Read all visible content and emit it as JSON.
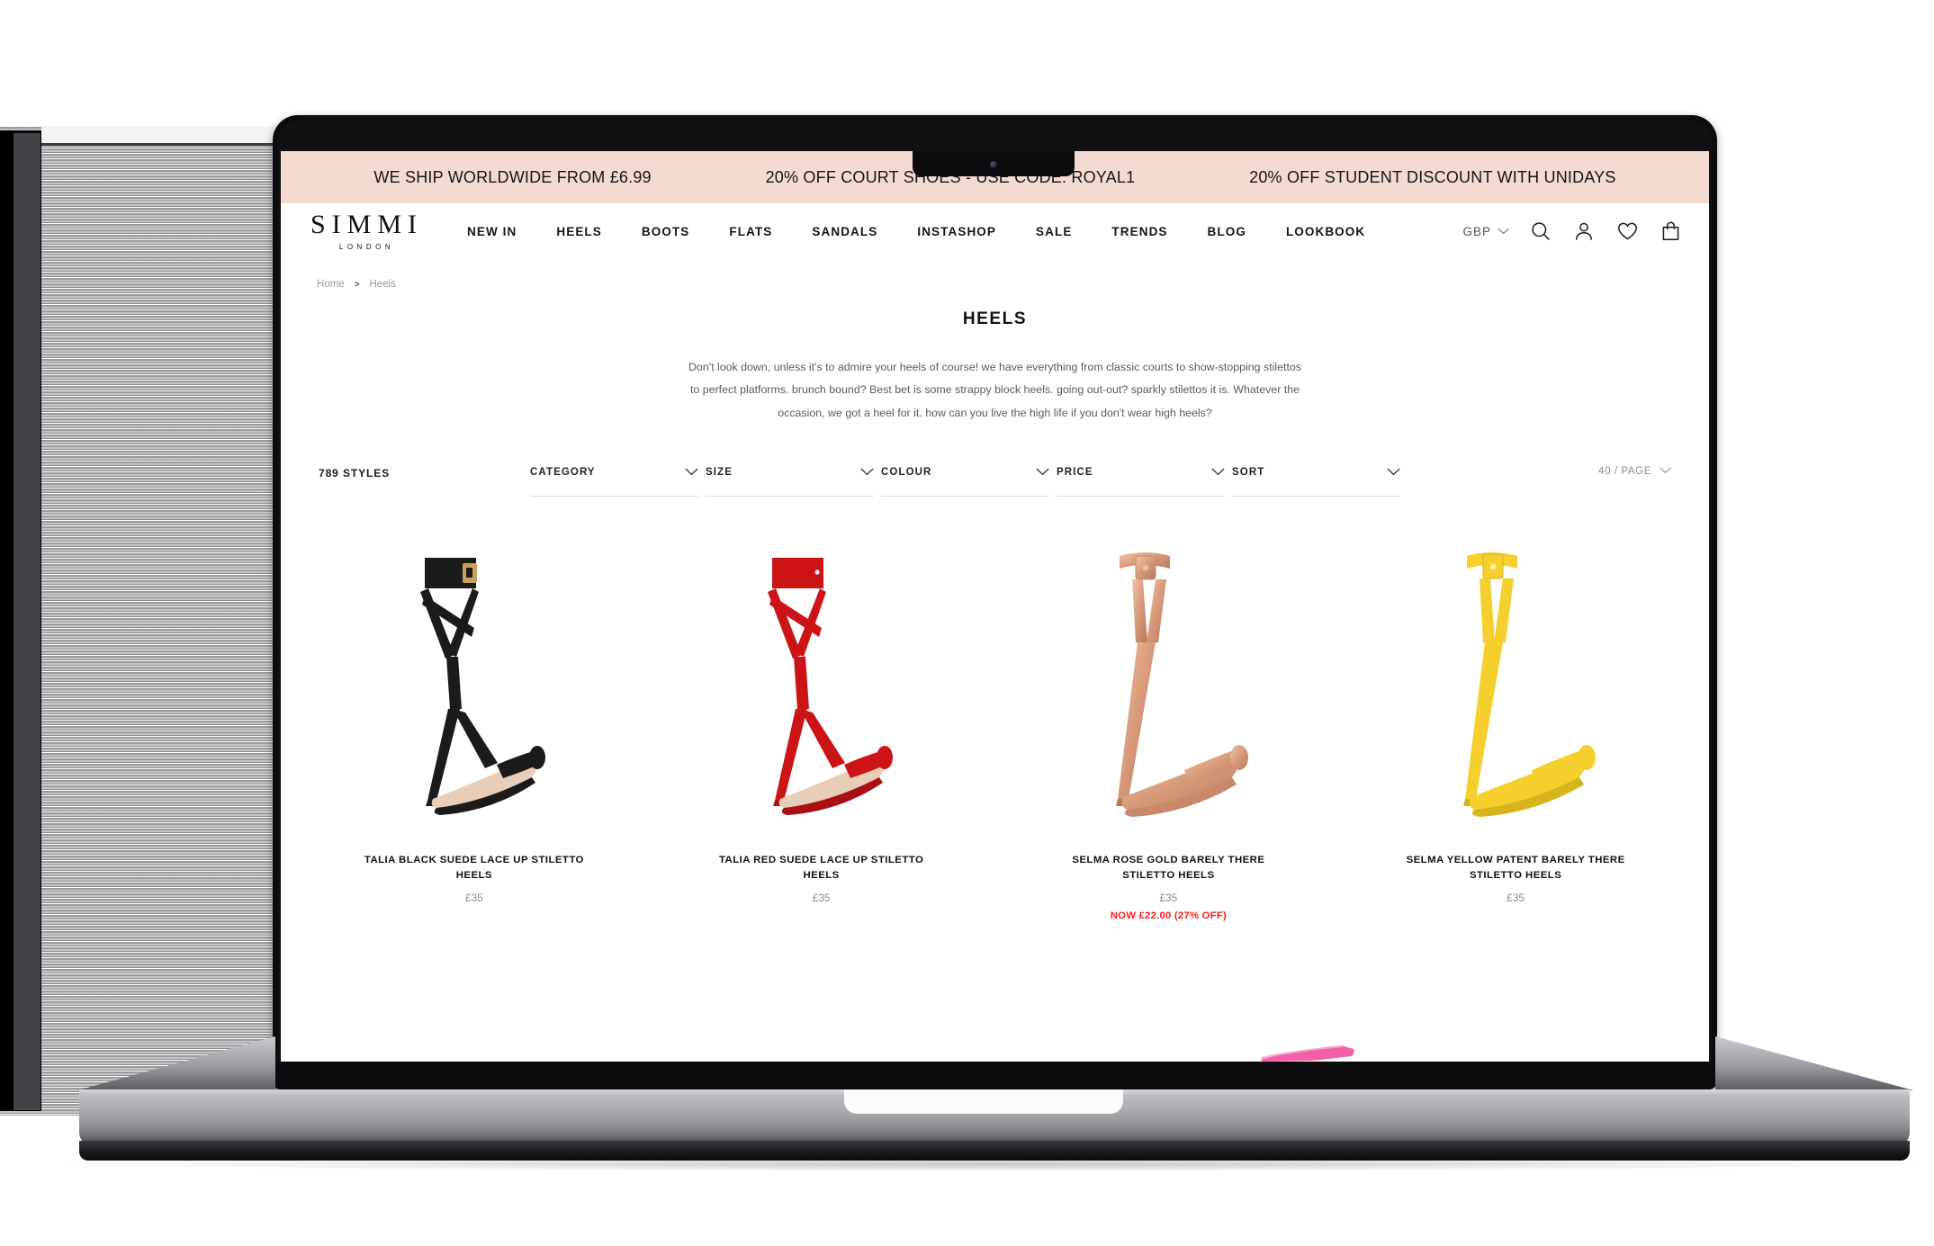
{
  "promo_bar": {
    "messages": [
      "WE SHIP WORLDWIDE FROM £6.99",
      "20% OFF COURT SHOES - USE CODE: ROYAL1",
      "20% OFF STUDENT DISCOUNT WITH UNIDAYS"
    ],
    "background_color": "#f4dbd2"
  },
  "header": {
    "logo_main": "SIMMI",
    "logo_sub": "LONDON",
    "nav_links": [
      "NEW IN",
      "HEELS",
      "BOOTS",
      "FLATS",
      "SANDALS",
      "INSTASHOP",
      "SALE",
      "TRENDS",
      "BLOG",
      "LOOKBOOK"
    ],
    "currency": "GBP",
    "icons": [
      "search-icon",
      "account-icon",
      "wishlist-heart-icon",
      "shopping-bag-icon"
    ]
  },
  "breadcrumb": {
    "home": "Home",
    "separator": ">",
    "current": "Heels"
  },
  "page": {
    "title": "HEELS",
    "description": "Don't look down, unless it's to admire your heels of course! we have everything from classic courts to show-stopping stilettos to perfect platforms. brunch bound? Best bet is some strappy block heels. going out-out? sparkly stilettos it is. Whatever the occasion, we got a heel for it. how can you live the high life if you don't wear high heels?"
  },
  "filter_bar": {
    "styles_count": "789 STYLES",
    "filters": [
      {
        "label": "CATEGORY"
      },
      {
        "label": "SIZE"
      },
      {
        "label": "COLOUR"
      },
      {
        "label": "PRICE"
      },
      {
        "label": "SORT"
      }
    ],
    "per_page": "40 / PAGE"
  },
  "products": [
    {
      "title": "TALIA BLACK SUEDE LACE UP STILETTO HEELS",
      "price": "£35",
      "sale": "",
      "colors": {
        "main": "#1b1b1b",
        "accent": "#2a2a2a",
        "sole": "#e8cdb9"
      }
    },
    {
      "title": "TALIA RED SUEDE LACE UP STILETTO HEELS",
      "price": "£35",
      "sale": "",
      "colors": {
        "main": "#cc1417",
        "accent": "#a81013",
        "sole": "#e8cdb9"
      }
    },
    {
      "title": "SELMA ROSE GOLD BARELY THERE STILETTO HEELS",
      "price": "£35",
      "sale": "NOW £22.00 (27% OFF)",
      "colors": {
        "main": "#d99d7c",
        "accent": "#c2835f",
        "sole": "#e8cdb9"
      }
    },
    {
      "title": "SELMA YELLOW PATENT BARELY THERE STILETTO HEELS",
      "price": "£35",
      "sale": "",
      "colors": {
        "main": "#f5cf2e",
        "accent": "#e0b81c",
        "sole": "#e8cdb9"
      }
    }
  ],
  "next_row_peek": {
    "color": "#f45fa8"
  }
}
